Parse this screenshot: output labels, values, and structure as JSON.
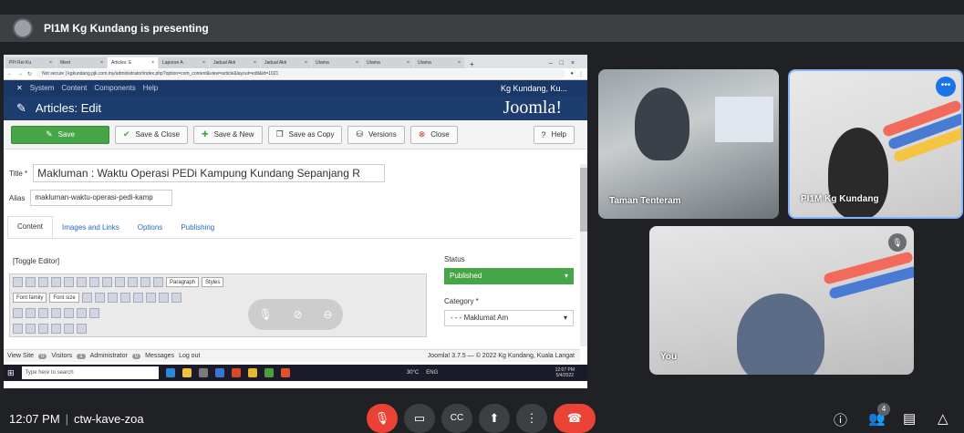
{
  "presenting": {
    "text": "PI1M Kg Kundang is presenting"
  },
  "browser": {
    "tabs": [
      "PPi Rei Ku",
      "Meet",
      "Articles: E",
      "Laporan A",
      "Jadual Akti",
      "Jadual Akti",
      "Utama",
      "Utama",
      "Utama"
    ],
    "url": "Not secure | kgkundang.pjk.com.my/administrator/index.php?option=com_content&view=article&layout=edit&id=1021"
  },
  "joomla": {
    "nav": [
      "System",
      "Content",
      "Components",
      "Help"
    ],
    "site_name": "Kg Kundang, Ku...",
    "page_title": "Articles: Edit",
    "logo": "Joomla!",
    "toolbar": {
      "save": "Save",
      "save_close": "Save & Close",
      "save_new": "Save & New",
      "save_copy": "Save as Copy",
      "versions": "Versions",
      "close": "Close",
      "help": "Help"
    },
    "form": {
      "title_label": "Title *",
      "title_value": "Makluman : Waktu Operasi PEDi Kampung Kundang Sepanjang R",
      "alias_label": "Alias",
      "alias_value": "makluman-waktu-operasi-pedi-kamp"
    },
    "tabs": [
      "Content",
      "Images and Links",
      "Options",
      "Publishing"
    ],
    "toggle_editor": "[Toggle Editor]",
    "editor": {
      "paragraph": "Paragraph",
      "styles": "Styles",
      "font_family": "Font family",
      "font_size": "Font size"
    },
    "status_label": "Status",
    "status_value": "Published",
    "category_label": "Category *",
    "category_value": "- - - Maklumat Am",
    "statusbar": {
      "view_site": "View Site",
      "visitors_count": "0",
      "visitors": "Visitors",
      "admin_count": "1",
      "admin": "Administrator",
      "messages_count": "0",
      "messages": "Messages",
      "logout": "Log out",
      "copyright": "Joomla! 3.7.5 — © 2022 Kg Kundang, Kuala Langat"
    }
  },
  "taskbar": {
    "search": "Type here to search",
    "temp": "30°C",
    "lang": "ENG",
    "time": "12:07 PM",
    "date": "5/4/2022"
  },
  "participants": [
    {
      "name": "Taman Tenteram"
    },
    {
      "name": "PI1M Kg Kundang"
    },
    {
      "name": "You"
    }
  ],
  "meeting": {
    "time": "12:07 PM",
    "code": "ctw-kave-zoa",
    "people_count": "4"
  },
  "colors": {
    "meet_bg": "#202124",
    "joomla_blue": "#1c3d6e",
    "save_green": "#46a546",
    "danger_red": "#ea4335"
  }
}
